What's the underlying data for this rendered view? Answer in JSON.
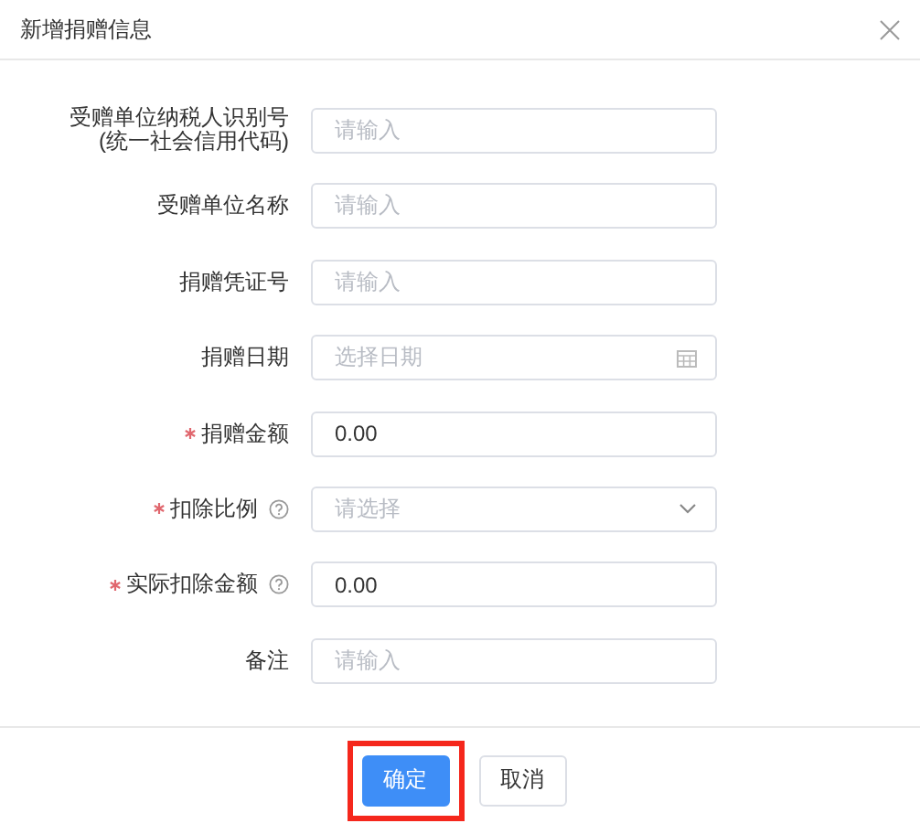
{
  "dialog": {
    "title": "新增捐赠信息"
  },
  "fields": [
    {
      "kind": "text",
      "label": "受赠单位纳税人识别号\n(统一社会信用代码)",
      "required": false,
      "help": false,
      "placeholder": "请输入"
    },
    {
      "kind": "text",
      "label": "受赠单位名称",
      "required": false,
      "help": false,
      "placeholder": "请输入"
    },
    {
      "kind": "text",
      "label": "捐赠凭证号",
      "required": false,
      "help": false,
      "placeholder": "请输入"
    },
    {
      "kind": "date",
      "label": "捐赠日期",
      "required": false,
      "help": false,
      "placeholder": "选择日期"
    },
    {
      "kind": "text",
      "label": "捐赠金额",
      "required": true,
      "help": false,
      "value": "0.00"
    },
    {
      "kind": "select",
      "label": "扣除比例",
      "required": true,
      "help": true,
      "placeholder": "请选择"
    },
    {
      "kind": "text",
      "label": "实际扣除金额",
      "required": true,
      "help": true,
      "value": "0.00"
    },
    {
      "kind": "text",
      "label": "备注",
      "required": false,
      "help": false,
      "placeholder": "请输入"
    }
  ],
  "buttons": [
    {
      "kind": "primary",
      "label": "确定",
      "highlighted": true
    },
    {
      "kind": "default",
      "label": "取消",
      "highlighted": false
    }
  ]
}
